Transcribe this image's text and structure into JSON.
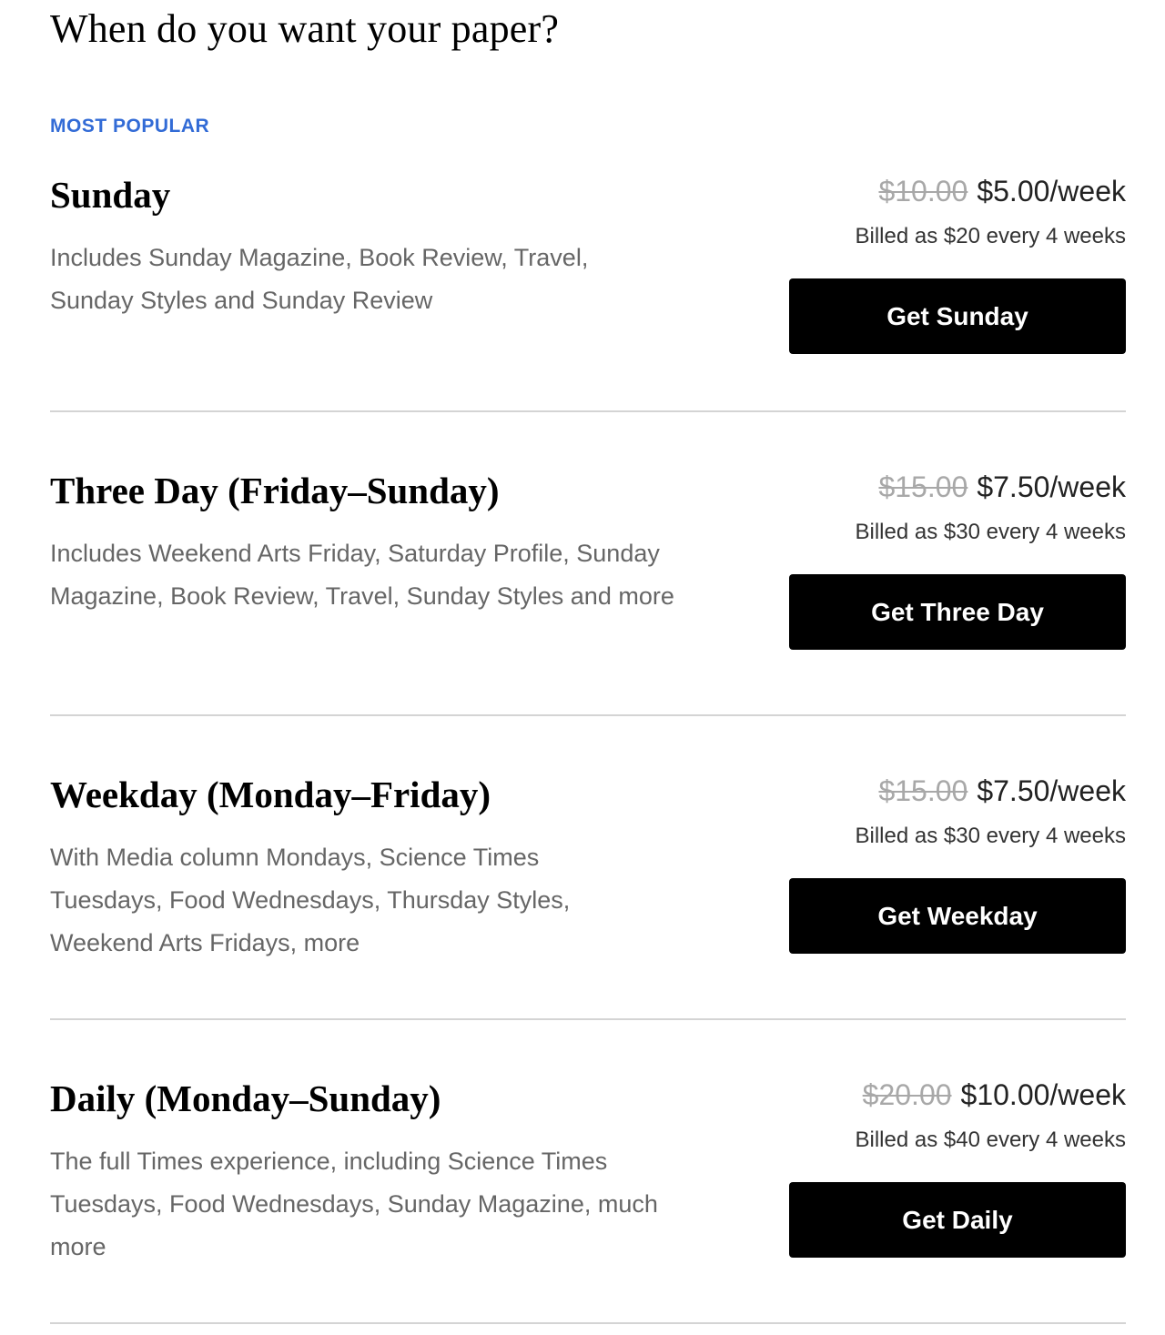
{
  "header": {
    "title": "When do you want your paper?"
  },
  "badge": {
    "label": "MOST POPULAR",
    "color": "#326bd6"
  },
  "plans": [
    {
      "name": "Sunday",
      "description": "Includes Sunday Magazine, Book Review, Travel, Sunday Styles and Sunday Review",
      "original_price": "$10.00",
      "price": "$5.00/week",
      "billing": "Billed as $20 every 4 weeks",
      "cta_label": "Get Sunday"
    },
    {
      "name": "Three Day (Friday–Sunday)",
      "description": "Includes Weekend Arts Friday, Saturday Profile, Sunday Magazine, Book Review, Travel, Sunday Styles and more",
      "original_price": "$15.00",
      "price": "$7.50/week",
      "billing": "Billed as $30 every 4 weeks",
      "cta_label": "Get Three Day"
    },
    {
      "name": "Weekday (Monday–Friday)",
      "description": "With Media column Mondays, Science Times Tuesdays, Food Wednesdays, Thursday Styles, Weekend Arts Fridays, more",
      "original_price": "$15.00",
      "price": "$7.50/week",
      "billing": "Billed as $30 every 4 weeks",
      "cta_label": "Get Weekday"
    },
    {
      "name": "Daily (Monday–Sunday)",
      "description": "The full Times experience, including Science Times Tuesdays, Food Wednesdays, Sunday Magazine, much more",
      "original_price": "$20.00",
      "price": "$10.00/week",
      "billing": "Billed as $40 every 4 weeks",
      "cta_label": "Get Daily"
    }
  ]
}
